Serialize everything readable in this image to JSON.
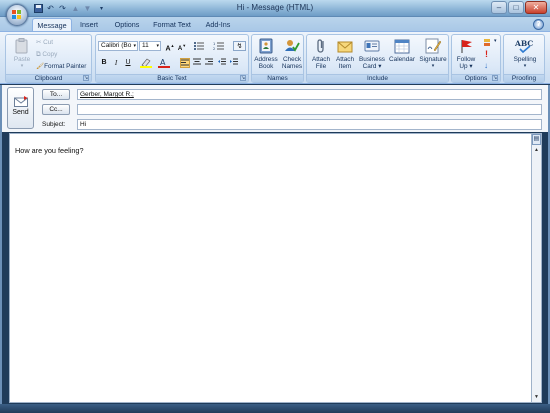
{
  "window": {
    "title": "Hi - Message (HTML)",
    "controls": [
      "–",
      "□",
      "✕"
    ]
  },
  "quick_access": [
    "save-icon",
    "undo-icon",
    "redo-icon",
    "up-icon",
    "down-icon",
    "customize-icon"
  ],
  "tabs": [
    {
      "label": "Message",
      "active": true
    },
    {
      "label": "Insert"
    },
    {
      "label": "Options"
    },
    {
      "label": "Format Text"
    },
    {
      "label": "Add-Ins"
    }
  ],
  "help_icon": "help-icon",
  "ribbon": {
    "clipboard": {
      "label": "Clipboard",
      "paste": "Paste",
      "cut": "Cut",
      "copy": "Copy",
      "format_painter": "Format Painter"
    },
    "basic_text": {
      "label": "Basic Text",
      "font": "Calibri (Bo",
      "size": "11",
      "bold": "B",
      "italic": "I",
      "underline": "U"
    },
    "names": {
      "label": "Names",
      "address_book": [
        "Address",
        "Book"
      ],
      "check_names": [
        "Check",
        "Names"
      ]
    },
    "include": {
      "label": "Include",
      "attach_file": [
        "Attach",
        "File"
      ],
      "attach_item": [
        "Attach",
        "Item"
      ],
      "business_card": [
        "Business",
        "Card ▾"
      ],
      "calendar": "Calendar",
      "signature": "Signature"
    },
    "options": {
      "label": "Options",
      "follow_up": [
        "Follow",
        "Up ▾"
      ]
    },
    "proofing": {
      "label": "Proofing",
      "spelling": "Spelling",
      "abc": "ABC"
    }
  },
  "compose": {
    "send": "Send",
    "to_button": "To...",
    "cc_button": "Cc...",
    "subject_label": "Subject:",
    "to_value": "Gerber, Margot R.;",
    "cc_value": "",
    "subject_value": "Hi",
    "body": "How are you feeling?"
  },
  "colors": {
    "ribbon_border": "#8db2e3",
    "title_gradient_top": "#bcd9ee",
    "frame": "#1f3b5a"
  }
}
